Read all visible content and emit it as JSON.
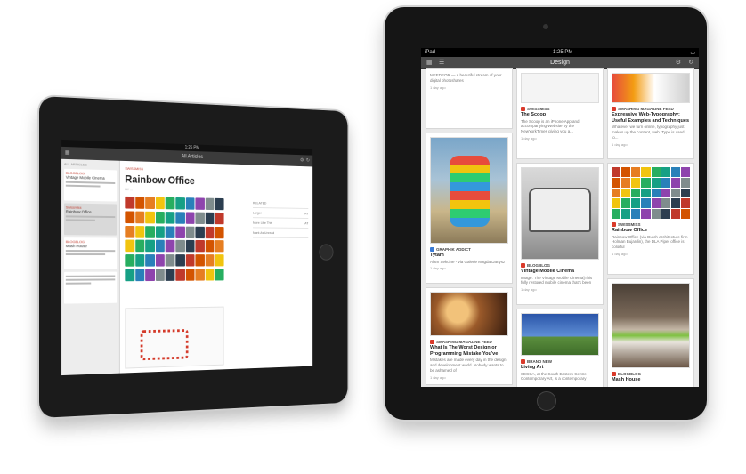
{
  "left_ipad": {
    "status_time": "1:25 PM",
    "nav_title": "All Articles",
    "list_header": "ALL ARTICLES",
    "list_items": [
      {
        "source": "BLOGBLOG",
        "title": "Vintage Mobile Cinema"
      },
      {
        "source": "Swissmiss",
        "title": "Rainbow Office",
        "selected": true
      },
      {
        "source": "BLOGBLOG",
        "title": "Mash House"
      }
    ],
    "article": {
      "source": "SWISSMISS",
      "title": "Rainbow Office",
      "meta": "BY ...",
      "side_rows": [
        {
          "label": "Larger",
          "value": "AT"
        },
        {
          "label": "More Like This",
          "value": "AT"
        },
        {
          "label": "Mark As Unread",
          "value": ""
        }
      ],
      "side_header": "RELATED"
    },
    "chip_colors": [
      "#c0392b",
      "#d35400",
      "#e67e22",
      "#f1c40f",
      "#27ae60",
      "#16a085",
      "#2980b9",
      "#8e44ad",
      "#7f8c8d",
      "#2c3e50"
    ]
  },
  "right_ipad": {
    "status_left": "iPad",
    "status_time": "1:25 PM",
    "nav_title": "Design",
    "cards": [
      {
        "col": 0,
        "title": "",
        "source": "",
        "text": "MEEDEOR — A beautiful stream of your digital photoshares",
        "age": "1 day ago"
      },
      {
        "col": 0,
        "title": "Tytam",
        "source": "GRAPHIK ADDICT",
        "text": "Alam Sekcine - via Galerie Magda Danysz",
        "age": "1 day ago"
      },
      {
        "col": 0,
        "title": "What Is The Worst Design or Programming Mistake You've",
        "source": "SMASHING MAGAZINE FEED",
        "text": "Mistakes are made every day in the design and development world. Nobody wants to be ashamed of",
        "age": "1 day ago"
      },
      {
        "col": 1,
        "title": "The Scoop",
        "source": "SWISSMISS",
        "text": "The Scoop is an iPhone App and accompanying Website by the NewYorkTimes giving you a...",
        "age": "1 day ago"
      },
      {
        "col": 1,
        "title": "Vintage Mobile Cinema",
        "source": "BLOGBLOG",
        "text": "Image: The Vintage Mobile Cinema]This fully restored mobile cinema that's been",
        "age": "1 day ago"
      },
      {
        "col": 1,
        "title": "Living Art",
        "source": "BRAND NEW",
        "text": "SECCA, at the South Eastern Centre Contemporary Art, is a contemporary",
        "age": ""
      },
      {
        "col": 2,
        "title": "Expressive Web-Typography: Useful Examples and Techniques",
        "source": "SMASHING MAGAZINE FEED",
        "text": "Whatever we turn online, typography just makes up the content, web. Type is used to...",
        "age": "1 day ago"
      },
      {
        "col": 2,
        "title": "Rainbow Office",
        "source": "SWISSMISS",
        "text": "Rainbow Office (via Dutch architecture firm Holman Bujardin), the DLA Piper office is colorful",
        "age": "1 day ago"
      },
      {
        "col": 2,
        "title": "Mash House",
        "source": "BLOGBLOG",
        "text": "",
        "age": ""
      }
    ]
  }
}
